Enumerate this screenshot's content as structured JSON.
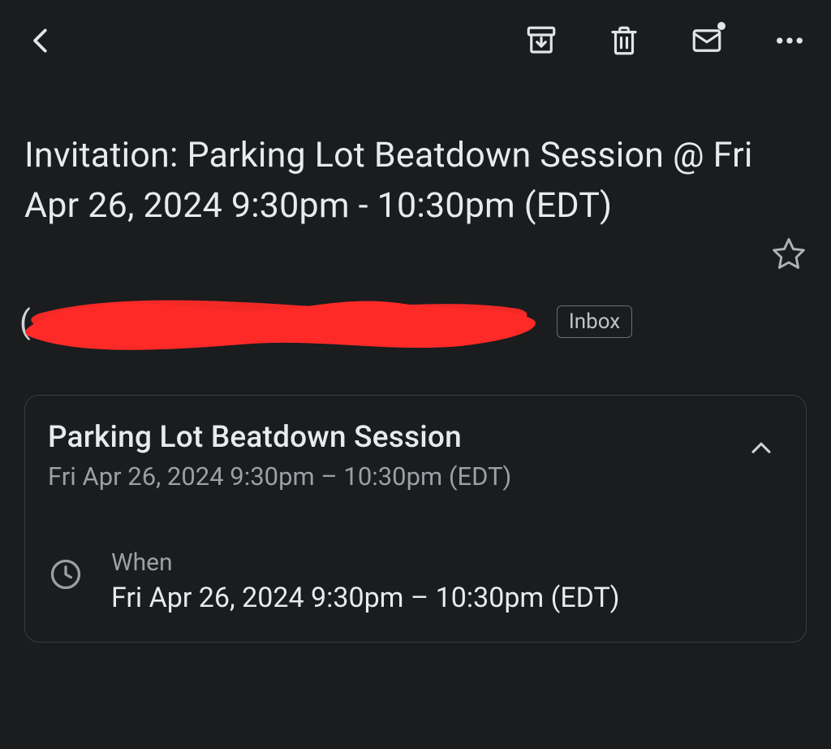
{
  "subject": "Invitation: Parking Lot Beatdown Session @ Fri Apr 26, 2024 9:30pm - 10:30pm (EDT)",
  "sender_prefix": "(",
  "label": "Inbox",
  "card": {
    "title": "Parking Lot Beatdown Session",
    "subtitle": "Fri Apr 26, 2024 9:30pm – 10:30pm (EDT)",
    "when_label": "When",
    "when_value": "Fri Apr 26, 2024 9:30pm – 10:30pm (EDT)"
  }
}
